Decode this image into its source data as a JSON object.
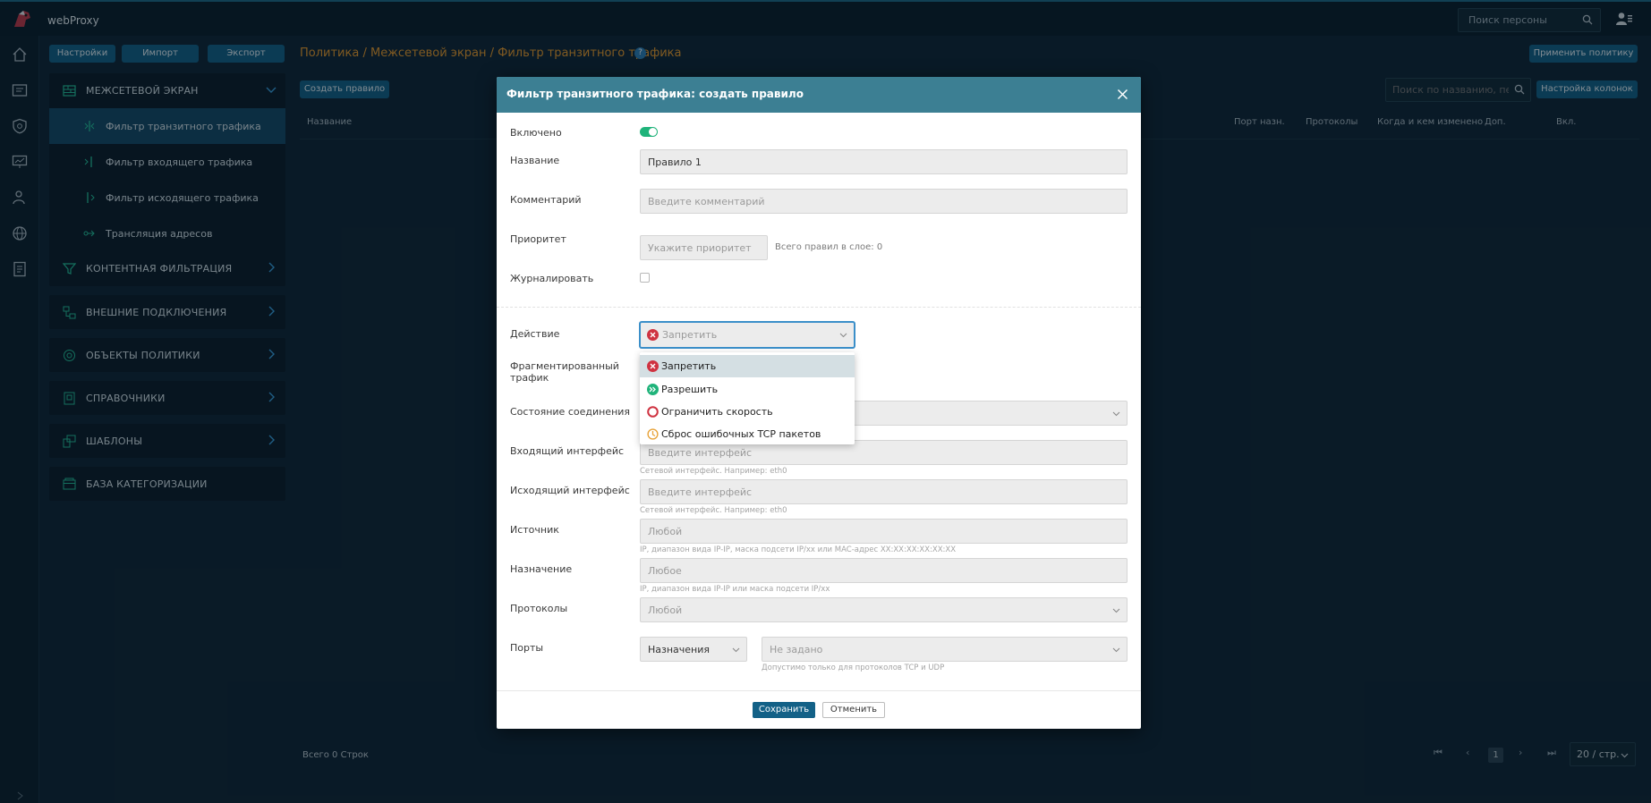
{
  "app": {
    "title": "webProxy"
  },
  "topbar": {
    "person_search_placeholder": "Поиск персоны"
  },
  "toolbar": {
    "settings": "Настройки",
    "import": "Импорт",
    "export": "Экспорт",
    "apply_policy": "Применить политику",
    "create_rule": "Создать правило",
    "search_placeholder": "Поиск по названию, пе...",
    "columns_settings": "Настройка колонок"
  },
  "breadcrumb": "Политика / Межсетевой экран / Фильтр транзитного трафика",
  "sidebar": {
    "groups": [
      {
        "label": "МЕЖСЕТЕВОЙ ЭКРАН",
        "expanded": true,
        "icon": "firewall-icon"
      },
      {
        "label": "КОНТЕНТНАЯ ФИЛЬТРАЦИЯ",
        "expanded": false,
        "icon": "content-filter-icon"
      },
      {
        "label": "ВНЕШНИЕ ПОДКЛЮЧЕНИЯ",
        "expanded": false,
        "icon": "connections-icon"
      },
      {
        "label": "ОБЪЕКТЫ ПОЛИТИКИ",
        "expanded": false,
        "icon": "objects-icon"
      },
      {
        "label": "СПРАВОЧНИКИ",
        "expanded": false,
        "icon": "reference-icon"
      },
      {
        "label": "ШАБЛОНЫ",
        "expanded": false,
        "icon": "templates-icon"
      },
      {
        "label": "БАЗА КАТЕГОРИЗАЦИИ",
        "expanded": false,
        "icon": "categorization-icon"
      }
    ],
    "firewall_items": [
      {
        "label": "Фильтр транзитного трафика",
        "active": true
      },
      {
        "label": "Фильтр входящего трафика",
        "active": false
      },
      {
        "label": "Фильтр исходящего трафика",
        "active": false
      },
      {
        "label": "Трансляция адресов",
        "active": false
      }
    ]
  },
  "table": {
    "columns": [
      "Название",
      "Порт назн.",
      "Протоколы",
      "Когда и кем изменено",
      "Доп.",
      "Вкл."
    ],
    "total": "Всего 0 Строк",
    "page": "1",
    "page_size": "20 / стр."
  },
  "modal": {
    "title": "Фильтр транзитного трафика: создать правило",
    "enabled_label": "Включено",
    "enabled": true,
    "name_label": "Название",
    "name_value": "Правило 1",
    "comment_label": "Комментарий",
    "comment_placeholder": "Введите комментарий",
    "priority_label": "Приоритет",
    "priority_placeholder": "Укажите приоритет",
    "priority_note": "Всего правил в слое: 0",
    "log_label": "Журналировать",
    "log_checked": false,
    "action_label": "Действие",
    "action_value": "Запретить",
    "action_options": [
      {
        "label": "Запретить",
        "icon": "deny-icon",
        "color": "#cf3341"
      },
      {
        "label": "Разрешить",
        "icon": "allow-icon",
        "color": "#1fb37a"
      },
      {
        "label": "Ограничить скорость",
        "icon": "limit-icon",
        "color": "#cf3341"
      },
      {
        "label": "Сброс ошибочных TCP пакетов",
        "icon": "reset-icon",
        "color": "#e8a33a"
      }
    ],
    "fragmented_label": "Фрагментированный трафик",
    "state_label": "Состояние соединения",
    "in_iface_label": "Входящий интерфейс",
    "in_iface_placeholder": "Введите интерфейс",
    "in_iface_hint": "Сетевой интерфейс. Например: eth0",
    "out_iface_label": "Исходящий интерфейс",
    "out_iface_placeholder": "Введите интерфейс",
    "out_iface_hint": "Сетевой интерфейс. Например: eth0",
    "source_label": "Источник",
    "source_placeholder": "Любой",
    "source_hint": "IP, диапазон вида IP-IP, маска подсети IP/xx или MAC-адрес XX:XX:XX:XX:XX:XX",
    "dest_label": "Назначение",
    "dest_placeholder": "Любое",
    "dest_hint": "IP, диапазон вида IP-IP или маска подсети IP/xx",
    "protocols_label": "Протоколы",
    "protocols_placeholder": "Любой",
    "ports_label": "Порты",
    "ports_type": "Назначения",
    "ports_placeholder": "Не задано",
    "ports_hint": "Допустимо только для протоколов TCP и UDP",
    "save": "Сохранить",
    "cancel": "Отменить"
  },
  "colors": {
    "accent": "#136187",
    "breadcrumb": "#e89a2c",
    "modal_header": "#3c7f93",
    "deny": "#cf3341",
    "allow": "#1fb37a",
    "warn": "#e8a33a"
  }
}
